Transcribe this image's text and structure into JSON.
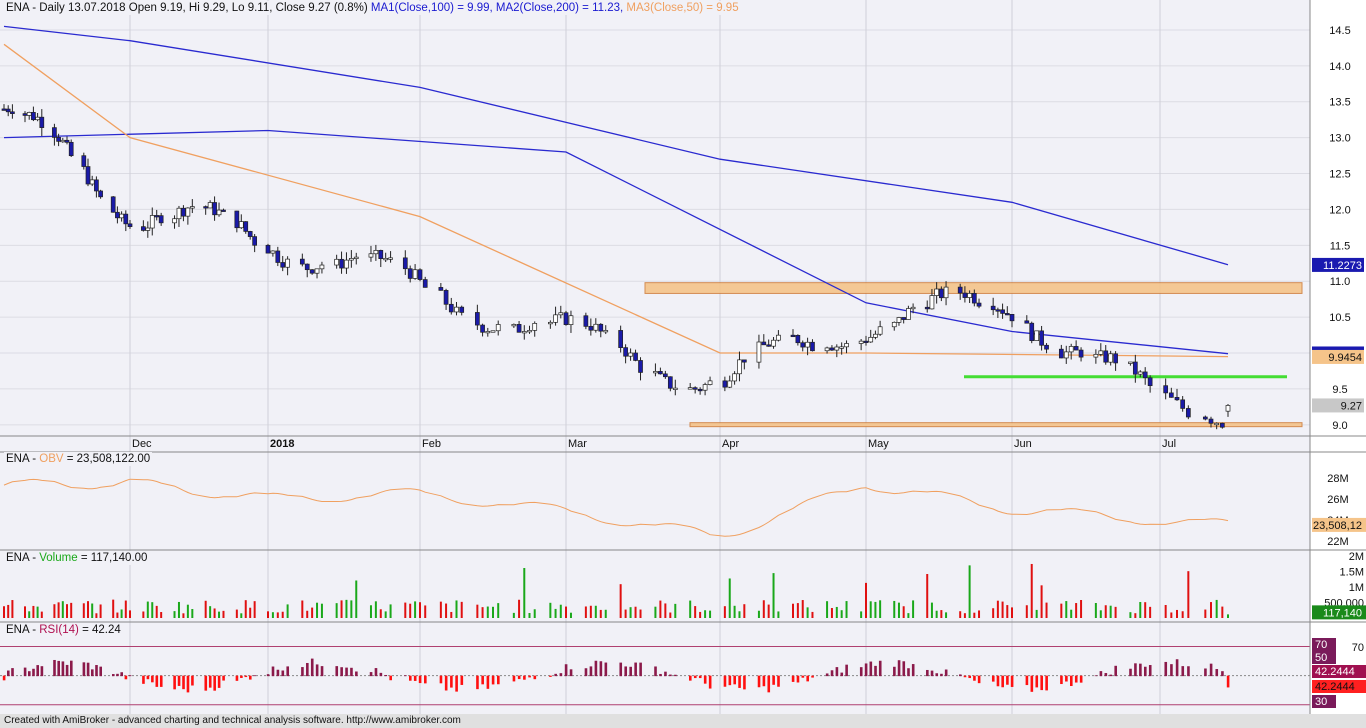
{
  "price_panel": {
    "symbol": "ENA",
    "interval": "Daily",
    "date": "13.07.2018",
    "open_label": "Open 9.19,",
    "hi_label": "Hi 9.29,",
    "lo_label": "Lo 9.11,",
    "close_label": "Close 9.27 (0.8%)",
    "ma1_label": "MA1(Close,100) = 9.99,",
    "ma2_label": "MA2(Close,200) = 11.23,",
    "ma3_label": "MA3(Close,50) = 9.95",
    "ma1_value": "9.9936",
    "ma2_value": "11.2273",
    "ma3_value": "9.9454",
    "last_close": "9.27",
    "axis_ticks": [
      "14.5",
      "14.0",
      "13.5",
      "13.0",
      "12.5",
      "12.0",
      "11.5",
      "11.0",
      "10.5",
      "10.0",
      "9.5",
      "9.0"
    ]
  },
  "x_axis_labels": [
    "Dec",
    "2018",
    "Feb",
    "Mar",
    "Apr",
    "May",
    "Jun",
    "Jul"
  ],
  "obv_panel": {
    "title_prefix": "ENA -",
    "indicator": "OBV",
    "title_value": "= 23,508,122.00",
    "last_value": "23,508,12",
    "axis_ticks": [
      "28M",
      "26M",
      "24M",
      "22M"
    ]
  },
  "volume_panel": {
    "title_prefix": "ENA -",
    "indicator": "Volume",
    "title_value": "= 117,140.00",
    "last_value": "117,140",
    "axis_ticks": [
      "2M",
      "1.5M",
      "1M",
      "500,000"
    ]
  },
  "rsi_panel": {
    "title_prefix": "ENA -",
    "indicator": "RSI(14)",
    "title_value": "= 42.24",
    "axis_ticks": [
      "70",
      "50",
      "70",
      "42.2444",
      "42.2444",
      "30"
    ]
  },
  "footer": "Created with AmiBroker - advanced charting and technical analysis software. http://www.amibroker.com",
  "colors": {
    "background": "#f1f1f7",
    "candle_up": "#ffffff",
    "candle_down": "#1a1aa8",
    "ma1": "#2a2ad0",
    "ma2": "#2a2ad0",
    "ma3": "#f0a060",
    "resistance_zone": "#f5c48a",
    "support_line": "#44dd33",
    "volume_up": "#1aa81a",
    "volume_down": "#e01010",
    "rsi_fill_up": "#8b1a4a",
    "rsi_fill_down": "#ff1010"
  },
  "chart_data": [
    {
      "type": "candlestick",
      "title": "ENA - Daily 13.07.2018",
      "x": [
        "2017-11-01",
        "2017-12-01",
        "2018-01-01",
        "2018-02-01",
        "2018-03-01",
        "2018-04-01",
        "2018-05-01",
        "2018-06-01",
        "2018-07-01",
        "2018-07-13"
      ],
      "close": [
        13.4,
        12.0,
        11.6,
        10.9,
        10.25,
        9.6,
        10.45,
        10.7,
        9.25,
        9.27
      ],
      "last_bar": {
        "open": 9.19,
        "high": 9.29,
        "low": 9.11,
        "close": 9.27
      },
      "ylim": [
        8.9,
        14.75
      ],
      "series": [
        {
          "name": "MA1(Close,100)",
          "x": [
            "2017-11-01",
            "2018-01-01",
            "2018-03-01",
            "2018-05-01",
            "2018-06-01",
            "2018-07-13"
          ],
          "values": [
            13.0,
            13.1,
            12.8,
            10.7,
            10.3,
            9.99
          ]
        },
        {
          "name": "MA2(Close,200)",
          "x": [
            "2017-11-01",
            "2017-12-01",
            "2018-02-01",
            "2018-04-01",
            "2018-06-01",
            "2018-07-13"
          ],
          "values": [
            14.55,
            14.35,
            13.7,
            12.7,
            12.1,
            11.23
          ]
        },
        {
          "name": "MA3(Close,50)",
          "x": [
            "2017-11-01",
            "2017-12-01",
            "2018-02-01",
            "2018-04-01",
            "2018-05-01",
            "2018-07-13"
          ],
          "values": [
            14.3,
            13.0,
            11.9,
            10.0,
            10.0,
            9.95
          ]
        }
      ],
      "annotations": [
        {
          "type": "zone",
          "from": 10.83,
          "to": 10.98,
          "label": "resistance"
        },
        {
          "type": "hline",
          "value": 9.67,
          "label": "support-green"
        },
        {
          "type": "zone",
          "from": 8.98,
          "to": 9.03,
          "label": "support-bottom"
        }
      ]
    },
    {
      "type": "line",
      "title": "OBV",
      "x": [
        "2017-11-01",
        "2017-12-01",
        "2018-01-01",
        "2018-02-01",
        "2018-03-01",
        "2018-04-01",
        "2018-05-01",
        "2018-06-01",
        "2018-07-13"
      ],
      "values": [
        27.3,
        27.5,
        26.0,
        26.5,
        24.8,
        22.4,
        27.4,
        25.0,
        23.508122
      ],
      "ylim": [
        21.5,
        29.5
      ]
    },
    {
      "type": "bar",
      "title": "Volume",
      "last_value": 117140,
      "ylim": [
        0,
        2000000
      ]
    },
    {
      "type": "area",
      "title": "RSI(14)",
      "last_value": 42.24,
      "levels": [
        70,
        50,
        30
      ],
      "ylim": [
        25,
        80
      ]
    }
  ]
}
